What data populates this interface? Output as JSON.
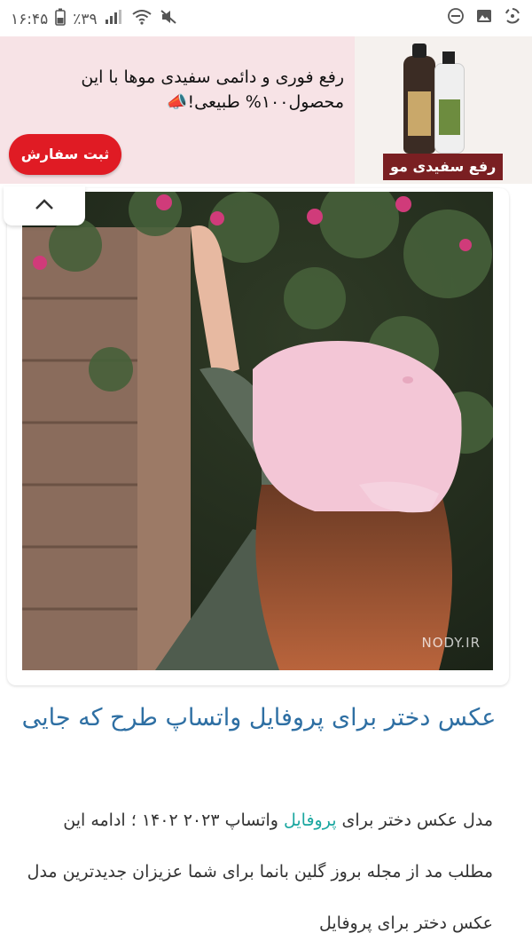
{
  "status_bar": {
    "time": "۱۶:۴۵",
    "battery": "٪۳۹",
    "icons": [
      "battery-icon",
      "signal-icon",
      "wifi-icon",
      "mute-icon",
      "dnd-icon",
      "image-icon",
      "sync-icon"
    ]
  },
  "ad": {
    "headline_line1": "رفع فوری و دائمی سفیدی موها با این",
    "headline_line2": "محصول۱۰۰% طبیعی!📣",
    "product_label": "رفع سفیدی مو",
    "cta_label": "ثبت سفارش",
    "colors": {
      "background": "#f7e3e6",
      "cta": "#e01b24"
    }
  },
  "collapse": {
    "icon": "chevron-up-icon"
  },
  "photo": {
    "watermark": "NODY.IR"
  },
  "article": {
    "title": "عکس دختر برای پروفایل واتساپ طرح که جایی",
    "para_prefix": "مدل عکس دختر برای ",
    "para_link": "پروفایل",
    "para_rest": " واتساپ ۲۰۲۳ ۱۴۰۲ ؛ ادامه این مطلب مد از مجله بروز گلین بانما برای شما عزیزان جدیدترین مدل عکس دختر برای پروفایل",
    "colors": {
      "title": "#2e6fa3",
      "link": "#1aa7a0"
    }
  }
}
